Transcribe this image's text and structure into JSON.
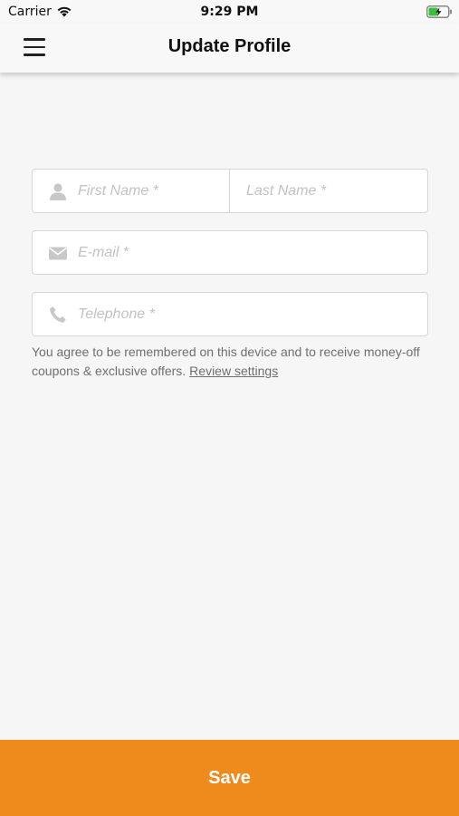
{
  "status_bar": {
    "carrier": "Carrier",
    "time": "9:29 PM",
    "wifi_icon": "wifi-icon",
    "battery_icon": "battery-charging-icon"
  },
  "nav": {
    "menu_icon": "hamburger-menu-icon",
    "title": "Update Profile"
  },
  "form": {
    "first_name": {
      "placeholder": "First Name *",
      "value": "",
      "icon": "person-icon"
    },
    "last_name": {
      "placeholder": "Last Name *",
      "value": ""
    },
    "email": {
      "placeholder": "E-mail *",
      "value": "",
      "icon": "envelope-icon"
    },
    "telephone": {
      "placeholder": "Telephone *",
      "value": "",
      "icon": "phone-icon"
    },
    "consent_text": "You agree to be remembered on this device and to receive money-off coupons & exclusive offers.",
    "review_link": "Review settings"
  },
  "footer": {
    "save_label": "Save"
  },
  "colors": {
    "accent": "#ef8b1c",
    "background": "#f6f6f6",
    "field_border": "#d6d6d6",
    "placeholder": "#c2c2c2"
  }
}
